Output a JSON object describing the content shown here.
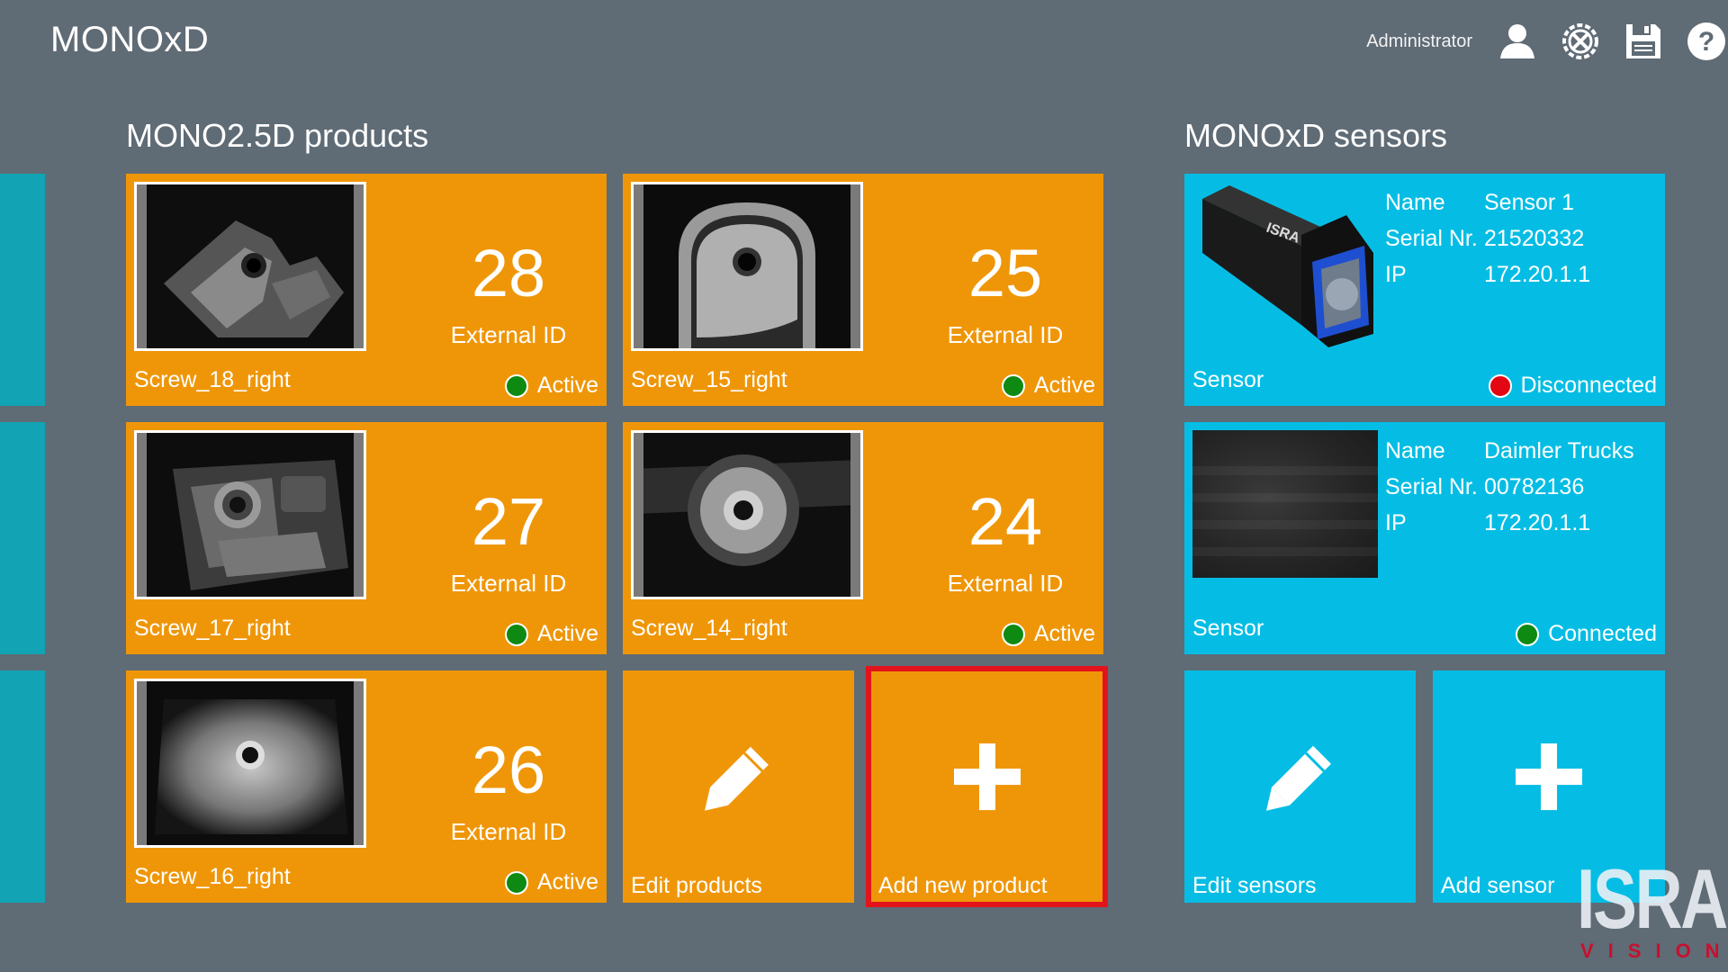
{
  "app": {
    "title": "MONOxD"
  },
  "topbar": {
    "user_label": "Administrator",
    "icons": [
      "user-icon",
      "settings-tools-icon",
      "save-icon",
      "help-icon"
    ]
  },
  "products": {
    "section_title": "MONO2.5D products",
    "caption": "External ID",
    "items": [
      {
        "name": "Screw_18_right",
        "external_id": "28",
        "status": "Active"
      },
      {
        "name": "Screw_15_right",
        "external_id": "25",
        "status": "Active"
      },
      {
        "name": "Screw_17_right",
        "external_id": "27",
        "status": "Active"
      },
      {
        "name": "Screw_14_right",
        "external_id": "24",
        "status": "Active"
      },
      {
        "name": "Screw_16_right",
        "external_id": "26",
        "status": "Active"
      }
    ],
    "edit_label": "Edit products",
    "add_label": "Add new product"
  },
  "sensors": {
    "section_title": "MONOxD sensors",
    "labels": {
      "name": "Name",
      "serial": "Serial Nr.",
      "ip": "IP"
    },
    "items": [
      {
        "type": "Sensor",
        "name": "Sensor 1",
        "serial": "21520332",
        "ip": "172.20.1.1",
        "status": "Disconnected"
      },
      {
        "type": "Sensor",
        "name": "Daimler Trucks",
        "serial": "00782136",
        "ip": "172.20.1.1",
        "status": "Connected"
      }
    ],
    "edit_label": "Edit sensors",
    "add_label": "Add sensor"
  },
  "logo": {
    "word": "ISRA",
    "sub": "VISION"
  },
  "colors": {
    "background": "#5f6b75",
    "product_tile": "#ef9608",
    "sensor_tile": "#05bde4",
    "strip": "#12a4b4",
    "selected_outline": "#e3131b",
    "active_dot": "#0e8a12",
    "disconnected_dot": "#e30613"
  }
}
